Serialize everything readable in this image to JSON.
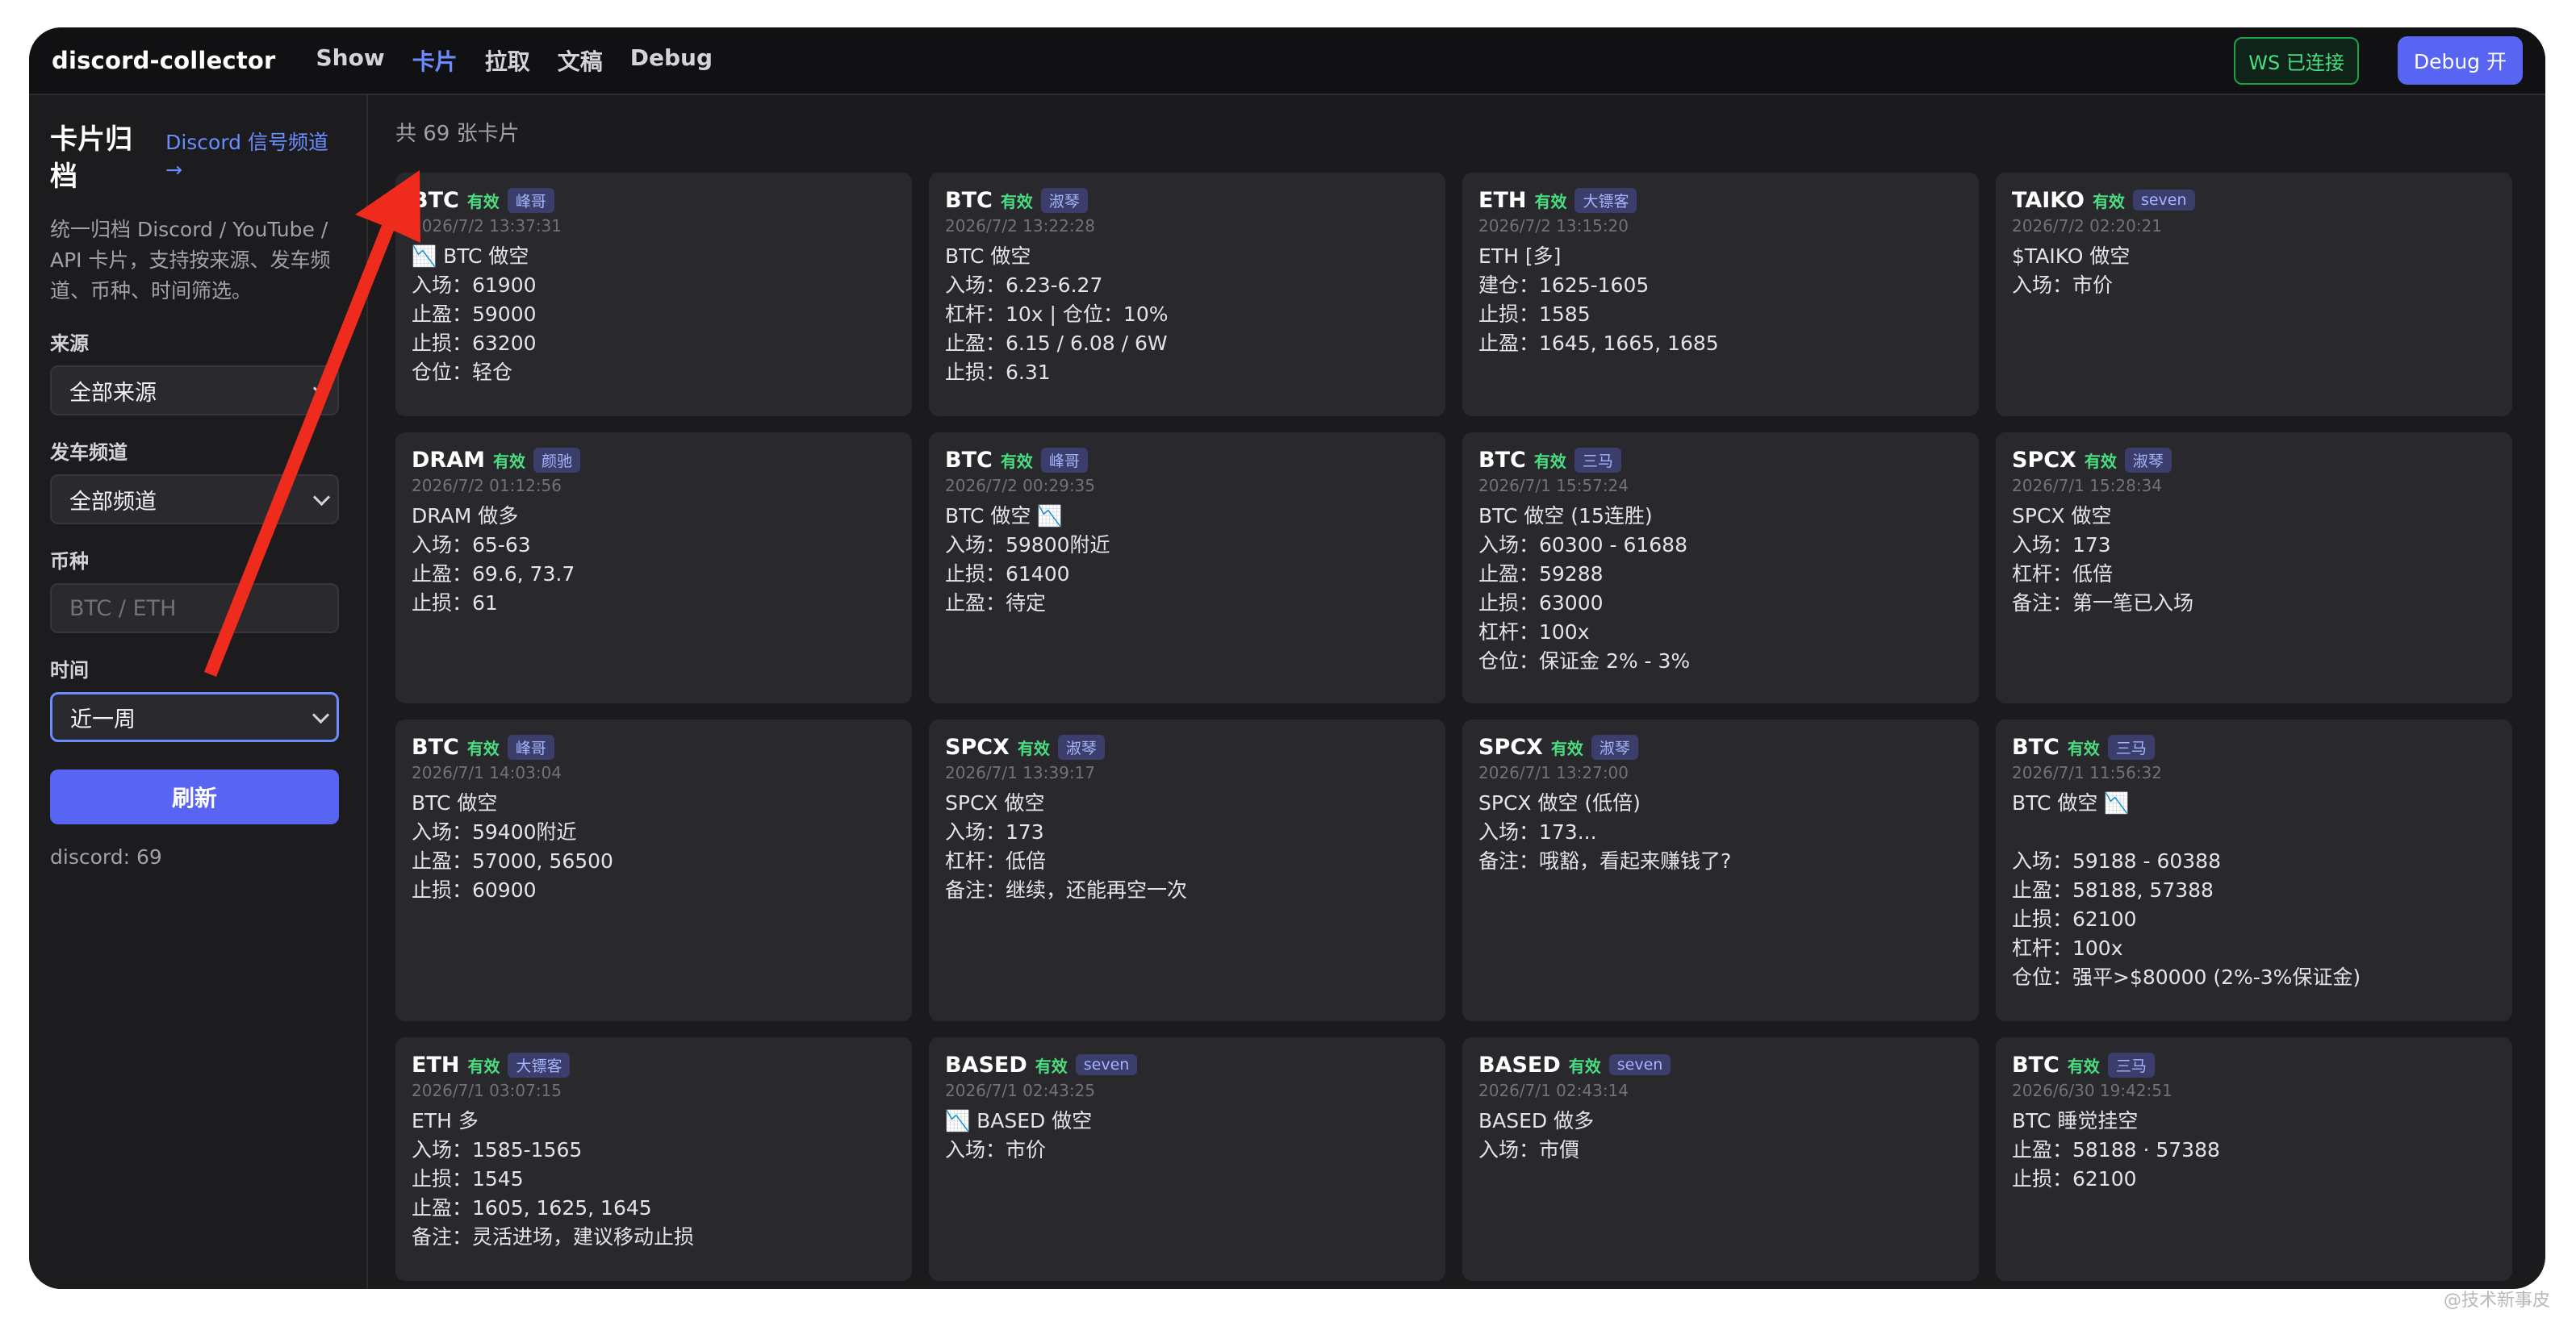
{
  "app": {
    "brand": "discord-collector",
    "nav": [
      {
        "label": "Show"
      },
      {
        "label": "卡片"
      },
      {
        "label": "拉取"
      },
      {
        "label": "文稿"
      },
      {
        "label": "Debug"
      }
    ],
    "ws_status": "WS 已连接",
    "debug_button": "Debug 开"
  },
  "sidebar": {
    "title": "卡片归档",
    "link": "Discord 信号频道 →",
    "description": "统一归档 Discord / YouTube / API 卡片，支持按来源、发车频道、币种、时间筛选。",
    "filters": {
      "source_label": "来源",
      "source_value": "全部来源",
      "channel_label": "发车频道",
      "channel_value": "全部频道",
      "coin_label": "币种",
      "coin_placeholder": "BTC / ETH",
      "time_label": "时间",
      "time_value": "近一周"
    },
    "refresh": "刷新",
    "count": "discord: 69"
  },
  "main": {
    "total": "共 69 张卡片",
    "cards": [
      {
        "symbol": "BTC",
        "status": "有效",
        "author": "峰哥",
        "time": "2026/7/2 13:37:31",
        "lines": [
          "📉 BTC 做空",
          "入场：61900",
          "止盈：59000",
          "止损：63200",
          "仓位：轻仓"
        ]
      },
      {
        "symbol": "BTC",
        "status": "有效",
        "author": "淑琴",
        "time": "2026/7/2 13:22:28",
        "lines": [
          "BTC 做空",
          "入场：6.23-6.27",
          "杠杆：10x | 仓位：10%",
          "止盈：6.15 / 6.08 / 6W",
          "止损：6.31"
        ]
      },
      {
        "symbol": "ETH",
        "status": "有效",
        "author": "大镖客",
        "time": "2026/7/2 13:15:20",
        "lines": [
          "ETH [多]",
          "建仓：1625-1605",
          "止损：1585",
          "止盈：1645, 1665, 1685"
        ]
      },
      {
        "symbol": "TAIKO",
        "status": "有效",
        "author": "seven",
        "time": "2026/7/2 02:20:21",
        "lines": [
          "$TAIKO 做空",
          "入场：市价"
        ]
      },
      {
        "symbol": "DRAM",
        "status": "有效",
        "author": "颜驰",
        "time": "2026/7/2 01:12:56",
        "lines": [
          "DRAM 做多",
          "入场：65-63",
          "止盈：69.6, 73.7",
          "止损：61"
        ]
      },
      {
        "symbol": "BTC",
        "status": "有效",
        "author": "峰哥",
        "time": "2026/7/2 00:29:35",
        "lines": [
          "BTC 做空 📉",
          "入场：59800附近",
          "止损：61400",
          "止盈：待定"
        ]
      },
      {
        "symbol": "BTC",
        "status": "有效",
        "author": "三马",
        "time": "2026/7/1 15:57:24",
        "lines": [
          "BTC 做空 (15连胜)",
          "入场：60300 - 61688",
          "止盈：59288",
          "止损：63000",
          "杠杆：100x",
          "仓位：保证金 2% - 3%"
        ]
      },
      {
        "symbol": "SPCX",
        "status": "有效",
        "author": "淑琴",
        "time": "2026/7/1 15:28:34",
        "lines": [
          "SPCX 做空",
          "入场：173",
          "杠杆：低倍",
          "备注：第一笔已入场"
        ]
      },
      {
        "symbol": "BTC",
        "status": "有效",
        "author": "峰哥",
        "time": "2026/7/1 14:03:04",
        "lines": [
          "BTC 做空",
          "入场：59400附近",
          "止盈：57000, 56500",
          "止损：60900"
        ]
      },
      {
        "symbol": "SPCX",
        "status": "有效",
        "author": "淑琴",
        "time": "2026/7/1 13:39:17",
        "lines": [
          "SPCX 做空",
          "入场：173",
          "杠杆：低倍",
          "备注：继续，还能再空一次"
        ]
      },
      {
        "symbol": "SPCX",
        "status": "有效",
        "author": "淑琴",
        "time": "2026/7/1 13:27:00",
        "lines": [
          "SPCX 做空 (低倍)",
          "入场：173...",
          "备注：哦豁，看起来赚钱了?"
        ]
      },
      {
        "symbol": "BTC",
        "status": "有效",
        "author": "三马",
        "time": "2026/7/1 11:56:32",
        "lines": [
          "BTC 做空 📉",
          " ",
          "入场：59188 - 60388",
          "止盈：58188, 57388",
          "止损：62100",
          "杠杆：100x",
          "仓位：强平>$80000 (2%-3%保证金)"
        ]
      },
      {
        "symbol": "ETH",
        "status": "有效",
        "author": "大镖客",
        "time": "2026/7/1 03:07:15",
        "lines": [
          "ETH 多",
          "入场：1585-1565",
          "止损：1545",
          "止盈：1605, 1625, 1645",
          "备注：灵活进场，建议移动止损"
        ]
      },
      {
        "symbol": "BASED",
        "status": "有效",
        "author": "seven",
        "time": "2026/7/1 02:43:25",
        "lines": [
          "📉 BASED 做空",
          "入场：市价"
        ]
      },
      {
        "symbol": "BASED",
        "status": "有效",
        "author": "seven",
        "time": "2026/7/1 02:43:14",
        "lines": [
          "BASED 做多",
          "入场：市價"
        ]
      },
      {
        "symbol": "BTC",
        "status": "有效",
        "author": "三马",
        "time": "2026/6/30 19:42:51",
        "lines": [
          "BTC 睡觉挂空",
          "止盈：58188 · 57388",
          "止损：62100"
        ]
      }
    ]
  },
  "annotation": {
    "color": "#ef2b1e"
  },
  "watermark": "@技术新事皮"
}
